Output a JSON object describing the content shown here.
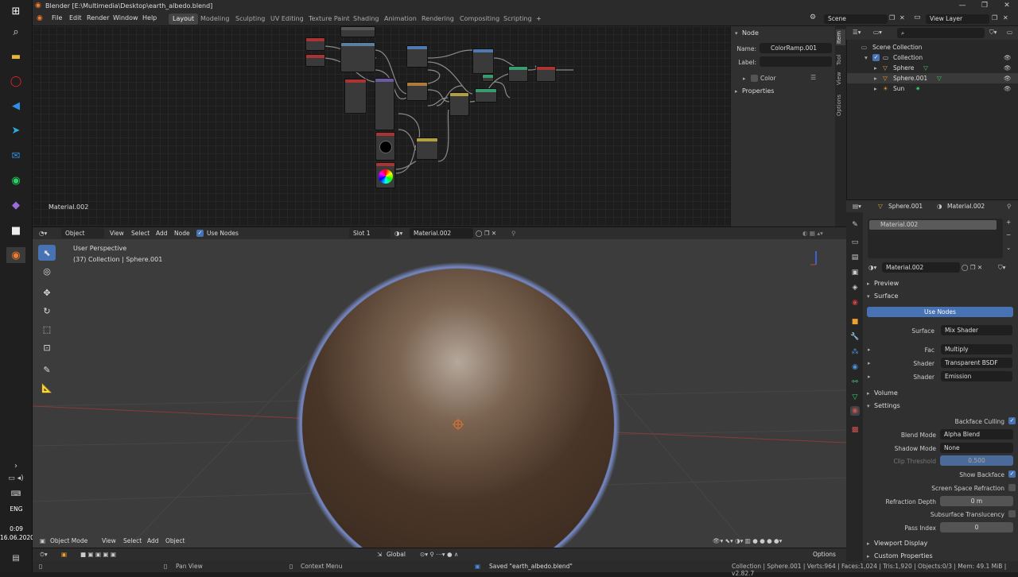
{
  "window": {
    "title": "Blender [E:\\Multimedia\\Desktop\\earth_albedo.blend]"
  },
  "menu": [
    "File",
    "Edit",
    "Render",
    "Window",
    "Help"
  ],
  "workspaces": [
    "Layout",
    "Modeling",
    "Sculpting",
    "UV Editing",
    "Texture Paint",
    "Shading",
    "Animation",
    "Rendering",
    "Compositing",
    "Scripting"
  ],
  "scene": {
    "label": "Scene",
    "view_layer": "View Layer"
  },
  "node_editor": {
    "material_label": "Material.002",
    "header": {
      "mode": "Object",
      "items": [
        "View",
        "Select",
        "Add",
        "Node"
      ],
      "use_nodes": "Use Nodes",
      "slot": "Slot 1",
      "material": "Material.002"
    }
  },
  "npanel": {
    "section": "Node",
    "name_label": "Name:",
    "name_value": "ColorRamp.001",
    "label_label": "Label:",
    "label_value": "",
    "color": "Color",
    "properties": "Properties",
    "tabs": [
      "Item",
      "Tool",
      "View",
      "Options"
    ]
  },
  "outliner": {
    "root": "Scene Collection",
    "items": [
      "Collection",
      "Sphere",
      "Sphere.001",
      "Sun"
    ]
  },
  "properties": {
    "header_object": "Sphere.001",
    "header_material": "Material.002",
    "slot": "Material.002",
    "material": "Material.002",
    "preview": "Preview",
    "surface_section": "Surface",
    "use_nodes": "Use Nodes",
    "rows": [
      {
        "label": "Surface",
        "value": "Mix Shader"
      },
      {
        "label": "Fac",
        "value": "Multiply"
      },
      {
        "label": "Shader",
        "value": "Transparent BSDF"
      },
      {
        "label": "Shader",
        "value": "Emission"
      }
    ],
    "volume": "Volume",
    "settings": "Settings",
    "backface_culling": "Backface Culling",
    "blend_mode_label": "Blend Mode",
    "blend_mode": "Alpha Blend",
    "shadow_mode_label": "Shadow Mode",
    "shadow_mode": "None",
    "clip_label": "Clip Threshold",
    "clip_value": "0.500",
    "show_backface": "Show Backface",
    "ssr": "Screen Space Refraction",
    "refraction_depth_label": "Refraction Depth",
    "refraction_depth": "0 m",
    "sss": "Subsurface Translucency",
    "pass_index_label": "Pass Index",
    "pass_index": "0",
    "viewport_display": "Viewport Display",
    "custom_properties": "Custom Properties"
  },
  "viewport": {
    "perspective": "User Perspective",
    "info": "(37) Collection | Sphere.001",
    "mode": "Object Mode",
    "items": [
      "View",
      "Select",
      "Add",
      "Object"
    ],
    "transform": "Global",
    "options": "Options"
  },
  "statusbar": {
    "pan": "Pan View",
    "context": "Context Menu",
    "saved": "Saved \"earth_albedo.blend\"",
    "stats": "Collection | Sphere.001 | Verts:964 | Faces:1,024 | Tris:1,920 | Objects:0/3 | Mem: 49.1 MiB | v2.82.7"
  },
  "taskbar": {
    "lang": "ENG",
    "time": "0:09",
    "date": "16.06.2020"
  },
  "colors": {
    "accent": "#4772b3",
    "sphere": "#4a3628",
    "rim": "#7b8fd0"
  }
}
